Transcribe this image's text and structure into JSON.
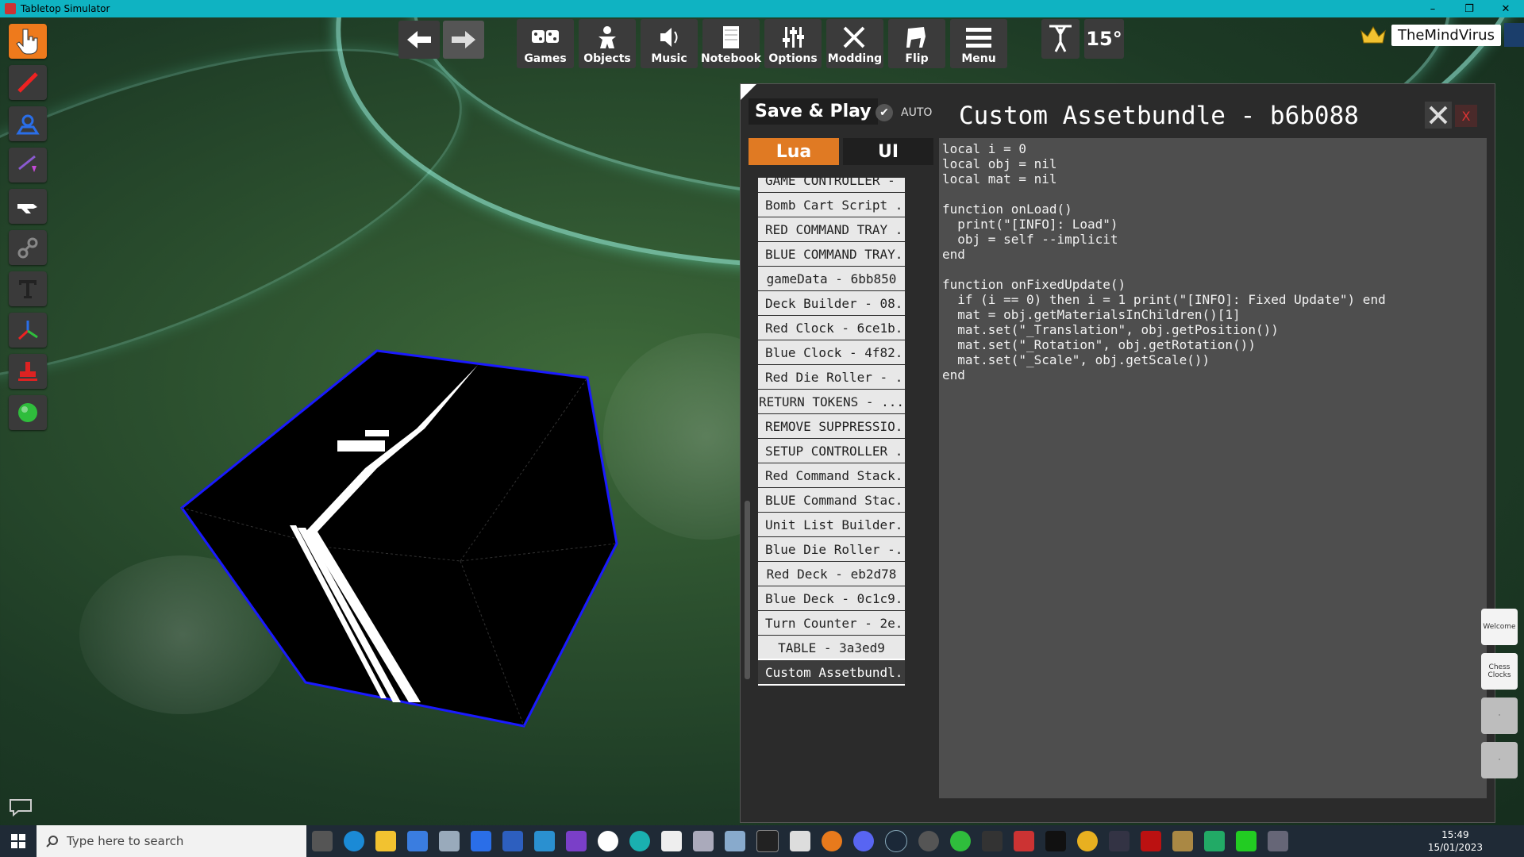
{
  "window": {
    "title": "Tabletop Simulator",
    "minimize": "–",
    "restore": "❐",
    "close": "✕"
  },
  "top_toolbar": {
    "back": "back",
    "forward": "forward",
    "buttons": [
      {
        "label": "Games",
        "icon": "games-icon"
      },
      {
        "label": "Objects",
        "icon": "objects-icon"
      },
      {
        "label": "Music",
        "icon": "music-icon"
      },
      {
        "label": "Notebook",
        "icon": "notebook-icon"
      },
      {
        "label": "Options",
        "icon": "options-icon"
      },
      {
        "label": "Modding",
        "icon": "modding-icon"
      },
      {
        "label": "Flip",
        "icon": "flip-icon"
      },
      {
        "label": "Menu",
        "icon": "menu-icon"
      }
    ],
    "rotation_label": "15°"
  },
  "user": {
    "name": "TheMindVirus",
    "crown_color": "#f2c230"
  },
  "left_tools": [
    "pointer",
    "draw",
    "zone",
    "line",
    "gizmo",
    "joint",
    "text",
    "flip-axis",
    "snap",
    "color-ball"
  ],
  "script_panel": {
    "save_label": "Save & Play",
    "auto_label": "AUTO",
    "title": "Custom Assetbundle - b6b088",
    "close_label": "X",
    "tab_lua": "Lua",
    "tab_ui": "UI",
    "scripts": [
      {
        "label": "GAME CONTROLLER - ...",
        "align": "left"
      },
      {
        "label": "Bomb Cart Script ...",
        "align": "left"
      },
      {
        "label": "RED COMMAND TRAY ...",
        "align": "left"
      },
      {
        "label": "BLUE COMMAND TRAY...",
        "align": "left"
      },
      {
        "label": "gameData - 6bb850",
        "align": "center"
      },
      {
        "label": "Deck Builder - 08...",
        "align": "left"
      },
      {
        "label": "Red Clock - 6ce1b...",
        "align": "left"
      },
      {
        "label": "Blue Clock - 4f82...",
        "align": "left"
      },
      {
        "label": "Red Die Roller - ...",
        "align": "left"
      },
      {
        "label": "RETURN TOKENS - ...",
        "align": "center"
      },
      {
        "label": "REMOVE SUPPRESSIO...",
        "align": "left"
      },
      {
        "label": "SETUP CONTROLLER ...",
        "align": "left"
      },
      {
        "label": "Red Command Stack...",
        "align": "left"
      },
      {
        "label": "BLUE Command Stac...",
        "align": "left"
      },
      {
        "label": "Unit List Builder...",
        "align": "left"
      },
      {
        "label": "Blue Die Roller -...",
        "align": "left"
      },
      {
        "label": "Red Deck - eb2d78",
        "align": "center"
      },
      {
        "label": "Blue Deck - 0c1c9...",
        "align": "left"
      },
      {
        "label": "Turn Counter - 2e...",
        "align": "left"
      },
      {
        "label": "TABLE - 3a3ed9",
        "align": "center"
      },
      {
        "label": "Custom Assetbundl...",
        "align": "left",
        "selected": true
      }
    ],
    "code": "local i = 0\nlocal obj = nil\nlocal mat = nil\n\nfunction onLoad()\n  print(\"[INFO]: Load\")\n  obj = self --implicit\nend\n\nfunction onFixedUpdate()\n  if (i == 0) then i = 1 print(\"[INFO]: Fixed Update\") end\n  mat = obj.getMaterialsInChildren()[1]\n  mat.set(\"_Translation\", obj.getPosition())\n  mat.set(\"_Rotation\", obj.getRotation())\n  mat.set(\"_Scale\", obj.getScale())\nend"
  },
  "side_notes": [
    {
      "label": "Welcome"
    },
    {
      "label": "Chess Clocks"
    },
    {
      "label": "·"
    },
    {
      "label": "·"
    }
  ],
  "taskbar": {
    "search_placeholder": "Type here to search",
    "time": "15:49",
    "date": "15/01/2023"
  }
}
